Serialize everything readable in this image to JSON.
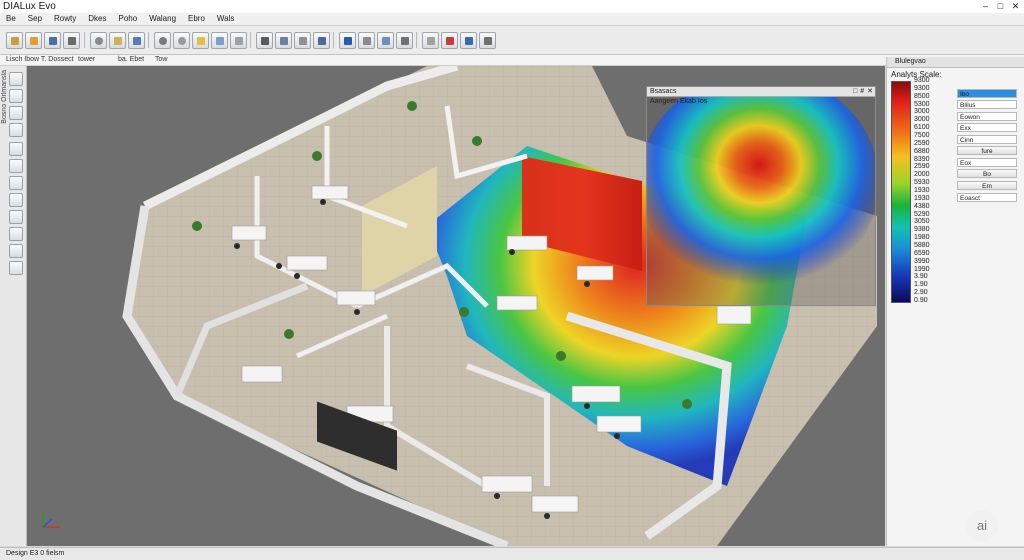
{
  "window": {
    "title": "DIALux Evo",
    "controls": [
      "–",
      "□",
      "✕"
    ]
  },
  "menu": [
    "Be",
    "Sep",
    "Rowty",
    "Dkes",
    "Poho",
    "Walang",
    "Ebro",
    "Wals"
  ],
  "toolbar": {
    "icons": [
      "open-icon",
      "save-icon",
      "camera-icon",
      "brush-icon",
      "delete-icon",
      "luminaire-icon",
      "window-icon",
      "settings-icon",
      "zoom-icon",
      "light-icon",
      "grid-icon",
      "group-icon",
      "edit-icon",
      "box-icon",
      "copy-icon",
      "crop-icon",
      "path-icon",
      "snap-icon",
      "tile-icon",
      "stairs-icon",
      "wand-icon",
      "measure-icon",
      "grid-4-icon",
      "paint-icon",
      "export-icon"
    ]
  },
  "addressbar": {
    "items": [
      "Lisch Ibow T. Dossect",
      "tower",
      "ba. Ebet",
      "Tow"
    ]
  },
  "left_panel": {
    "vertical_label": "Bosno Orlmansla",
    "tools": [
      "select-icon",
      "pencil-icon",
      "wall-icon",
      "door-icon",
      "window-tool-icon",
      "furniture-icon",
      "light-tool-icon",
      "calc-icon",
      "measure-tool-icon",
      "search-tool-icon",
      "plugin-icon",
      "view-icon"
    ]
  },
  "overlay": {
    "title": "Bsasacs",
    "subtitle": "Aangeen Ekab Ios",
    "controls": [
      "□",
      "#",
      "✕"
    ]
  },
  "right_panel": {
    "header": "Blulegvao",
    "scale_title": "Analyts Scale:",
    "scale_labels": [
      "9300",
      "9300",
      "8500",
      "5300",
      "3000",
      "3000",
      "6100",
      "7500",
      "2590",
      "6880",
      "8390",
      "2590",
      "2000",
      "5930",
      "1930",
      "1930",
      "4380",
      "5290",
      "3050",
      "9380",
      "1980",
      "5880",
      "6590",
      "3990",
      "1990",
      "3.90",
      "1.90",
      "2.90",
      "0.90"
    ],
    "properties": [
      {
        "label": "Ibo",
        "selected": true
      },
      {
        "label": "Blilus"
      },
      {
        "label": "Eowon"
      },
      {
        "label": "Exx"
      },
      {
        "label": "Cinn"
      },
      {
        "label": "fure",
        "button": true
      },
      {
        "label": "Eox"
      },
      {
        "label": "Bo",
        "button": true
      },
      {
        "label": "Em",
        "button": true
      },
      {
        "label": "Eoasct"
      }
    ]
  },
  "status": {
    "text": "Design E3 0 fielsm"
  },
  "badge": {
    "text": "ai"
  }
}
